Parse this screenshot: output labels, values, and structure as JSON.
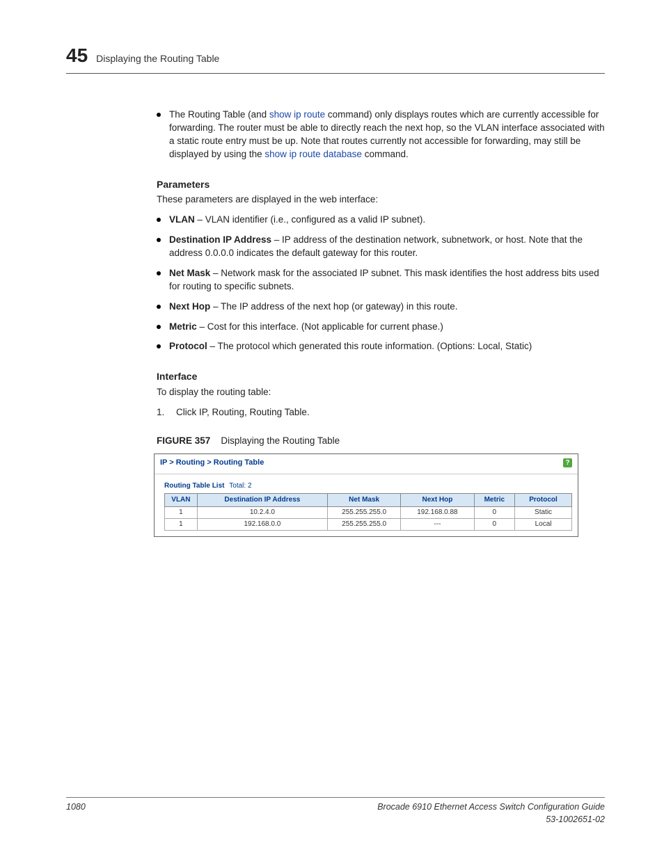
{
  "header": {
    "chapter_num": "45",
    "title": "Displaying the Routing Table"
  },
  "intro_bullet": {
    "pre": "The Routing Table (and ",
    "link1": "show ip route",
    "mid": " command) only displays routes which are currently accessible for forwarding. The router must be able to directly reach the next hop, so the VLAN interface associated with a static route entry must be up. Note that routes currently not accessible for forwarding, may still be displayed by using the ",
    "link2": "show ip route database",
    "post": " command."
  },
  "params": {
    "heading": "Parameters",
    "intro": "These parameters are displayed in the web interface:",
    "items": [
      {
        "name": "VLAN",
        "desc": " – VLAN identifier (i.e., configured as a valid IP subnet)."
      },
      {
        "name": "Destination IP Address",
        "desc": " – IP address of the destination network, subnetwork, or host. Note that the address 0.0.0.0 indicates the default gateway for this router."
      },
      {
        "name": "Net Mask",
        "desc": " – Network mask for the associated IP subnet. This mask identifies the host address bits used for routing to specific subnets."
      },
      {
        "name": "Next Hop",
        "desc": " – The IP address of the next hop (or gateway) in this route."
      },
      {
        "name": "Metric",
        "desc": " – Cost for this interface. (Not applicable for current phase.)"
      },
      {
        "name": "Protocol",
        "desc": " – The protocol which generated this route information. (Options: Local, Static)"
      }
    ]
  },
  "interface": {
    "heading": "Interface",
    "intro": "To display the routing table:",
    "step1_num": "1.",
    "step1_text": "Click IP, Routing, Routing Table."
  },
  "figure": {
    "label": "FIGURE 357",
    "caption": "Displaying the Routing Table"
  },
  "webui": {
    "breadcrumb": "IP > Routing > Routing Table",
    "list_title": "Routing Table List",
    "total_label": "Total: 2",
    "headers": [
      "VLAN",
      "Destination IP Address",
      "Net Mask",
      "Next Hop",
      "Metric",
      "Protocol"
    ],
    "rows": [
      [
        "1",
        "10.2.4.0",
        "255.255.255.0",
        "192.168.0.88",
        "0",
        "Static"
      ],
      [
        "1",
        "192.168.0.0",
        "255.255.255.0",
        "---",
        "0",
        "Local"
      ]
    ]
  },
  "footer": {
    "page": "1080",
    "book": "Brocade 6910 Ethernet Access Switch Configuration Guide",
    "docnum": "53-1002651-02"
  }
}
